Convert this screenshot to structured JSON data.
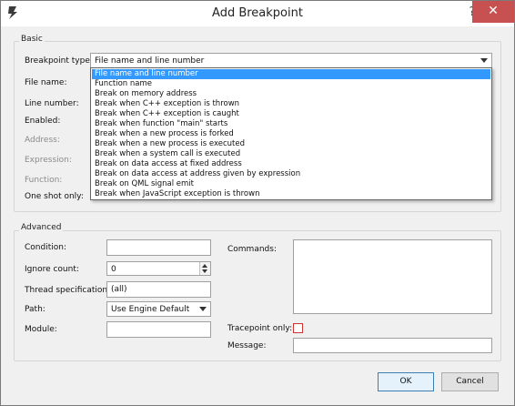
{
  "window": {
    "title": "Add Breakpoint",
    "help_glyph": "?",
    "close_glyph": "✕"
  },
  "basic": {
    "group_title": "Basic",
    "breakpoint_type_label": "Breakpoint type:",
    "breakpoint_type_value": "File name and line number",
    "file_name_label": "File name:",
    "line_number_label": "Line number:",
    "enabled_label": "Enabled:",
    "address_label": "Address:",
    "expression_label": "Expression:",
    "function_label": "Function:",
    "one_shot_label": "One shot only:",
    "type_options": [
      "File name and line number",
      "Function name",
      "Break on memory address",
      "Break when C++ exception is thrown",
      "Break when C++ exception is caught",
      "Break when function \"main\" starts",
      "Break when a new process is forked",
      "Break when a new process is executed",
      "Break when a system call is executed",
      "Break on data access at fixed address",
      "Break on data access at address given by expression",
      "Break on QML signal emit",
      "Break when JavaScript exception is thrown"
    ],
    "selected_index": 0
  },
  "advanced": {
    "group_title": "Advanced",
    "condition_label": "Condition:",
    "condition_value": "",
    "ignore_count_label": "Ignore count:",
    "ignore_count_value": "0",
    "thread_spec_label": "Thread specification:",
    "thread_spec_value": "(all)",
    "path_label": "Path:",
    "path_value": "Use Engine Default",
    "module_label": "Module:",
    "module_value": "",
    "commands_label": "Commands:",
    "tracepoint_label": "Tracepoint only:",
    "message_label": "Message:",
    "message_value": ""
  },
  "buttons": {
    "ok": "OK",
    "cancel": "Cancel"
  },
  "colors": {
    "selection": "#3399ff",
    "close_button": "#c75050",
    "window_bg": "#f0f0f0"
  }
}
